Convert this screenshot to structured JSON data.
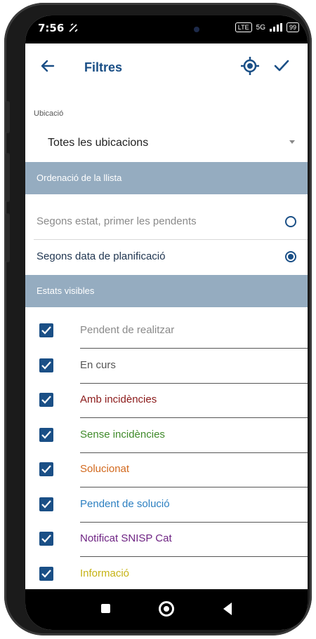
{
  "status_bar": {
    "time": "7:56",
    "signal_text": "5G",
    "battery": "99"
  },
  "app_bar": {
    "title": "Filtres"
  },
  "location": {
    "label": "Ubicació",
    "value": "Totes les ubicacions"
  },
  "sorting": {
    "header": "Ordenació de la llista",
    "options": [
      {
        "label": "Segons estat, primer les pendents",
        "selected": false
      },
      {
        "label": "Segons data de planificació",
        "selected": true
      }
    ]
  },
  "states": {
    "header": "Estats visibles",
    "items": [
      {
        "label": "Pendent de realitzar",
        "checked": true,
        "color": "#8a8a8a"
      },
      {
        "label": "En curs",
        "checked": true,
        "color": "#555555"
      },
      {
        "label": "Amb incidències",
        "checked": true,
        "color": "#8b1a1a"
      },
      {
        "label": "Sense incidències",
        "checked": true,
        "color": "#3f8a2a"
      },
      {
        "label": "Solucionat",
        "checked": true,
        "color": "#d2691e"
      },
      {
        "label": "Pendent de solució",
        "checked": true,
        "color": "#2b7fc1"
      },
      {
        "label": "Notificat SNISP Cat",
        "checked": true,
        "color": "#6e2383"
      },
      {
        "label": "Informació",
        "checked": true,
        "color": "#c6b315"
      }
    ]
  },
  "colors": {
    "accent": "#1a4f86",
    "section_bg": "#95acc0"
  }
}
